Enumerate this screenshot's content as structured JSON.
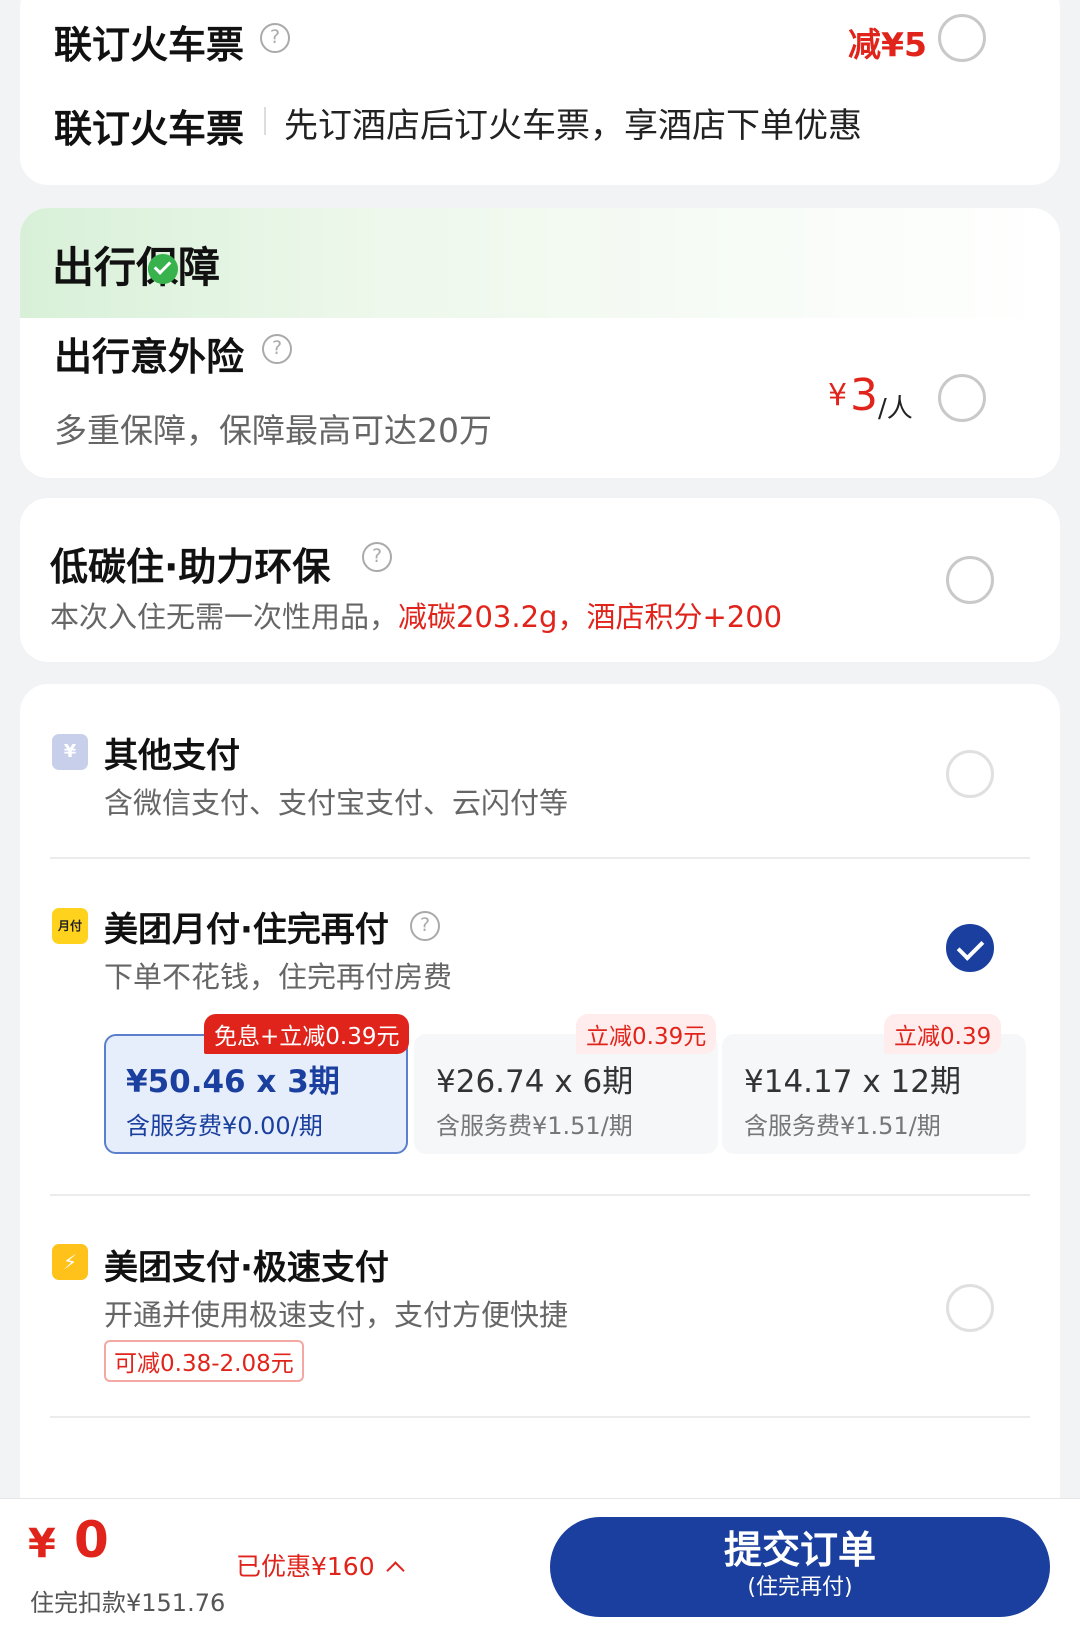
{
  "train_card": {
    "header_title": "联订火车票",
    "discount": "减¥5",
    "row_label": "联订火车票",
    "row_desc": "先订酒店后订火车票，享酒店下单优惠"
  },
  "insurance_card": {
    "section_title": "出行保障",
    "item_title": "出行意外险",
    "item_desc": "多重保障，保障最高可达20万",
    "price_symbol": "¥",
    "price_value": "3",
    "price_unit": "/人"
  },
  "eco_card": {
    "title": "低碳住·助力环保",
    "desc_plain": "本次入住无需一次性用品，",
    "desc_highlight": "减碳203.2g，酒店积分+200"
  },
  "payment": {
    "other": {
      "icon": "yen-icon",
      "icon_glyph": "¥",
      "title": "其他支付",
      "desc": "含微信支付、支付宝支付、云闪付等"
    },
    "monthly": {
      "icon": "monthly-pay-icon",
      "icon_glyph": "月付",
      "title": "美团月付·住完再付",
      "desc": "下单不花钱，住完再付房费",
      "plans": [
        {
          "tag": "免息+立减0.39元",
          "amount": "¥50.46 x 3期",
          "fee": "含服务费¥0.00/期",
          "selected": true
        },
        {
          "tag": "立减0.39元",
          "amount": "¥26.74 x 6期",
          "fee": "含服务费¥1.51/期",
          "selected": false
        },
        {
          "tag": "立减0.39",
          "amount": "¥14.17 x 12期",
          "fee": "含服务费¥1.51/期",
          "selected": false
        }
      ]
    },
    "quick": {
      "icon": "lightning-icon",
      "icon_glyph": "⚡",
      "title": "美团支付·极速支付",
      "desc": "开通并使用极速支付，支付方便快捷",
      "badge": "可减0.38-2.08元"
    }
  },
  "footer": {
    "total_symbol": "¥",
    "total_value": "0",
    "deduction": "住完扣款¥151.76",
    "saved": "已优惠¥160",
    "submit_label": "提交订单",
    "submit_sub": "(住完再付)"
  },
  "colors": {
    "accent_blue": "#1a3f9e",
    "discount_red": "#e0241b",
    "guarantee_green": "#37b24d"
  }
}
